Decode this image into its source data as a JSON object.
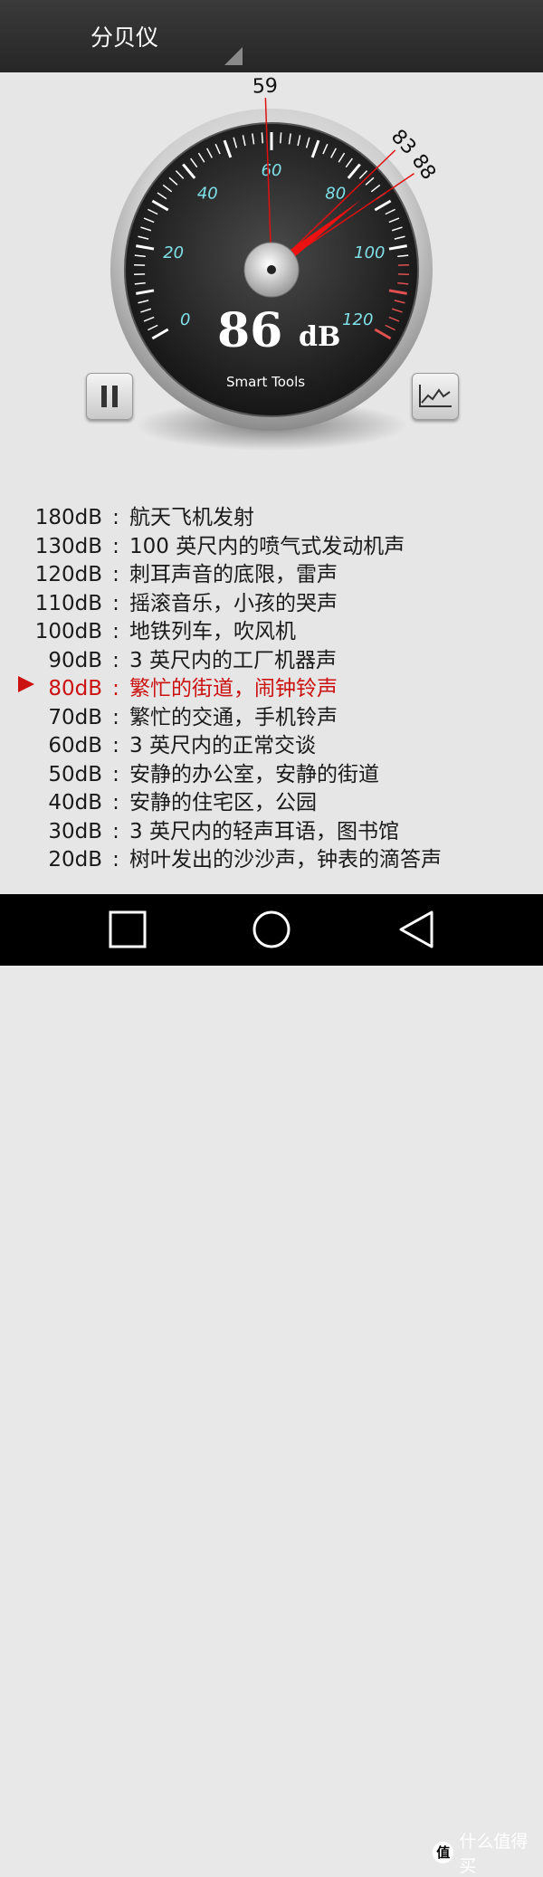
{
  "app": {
    "title": "分贝仪"
  },
  "gauge": {
    "reading": "86",
    "unit": "dB",
    "brand": "Smart Tools",
    "scale_labels": [
      "0",
      "20",
      "40",
      "60",
      "80",
      "100",
      "120"
    ],
    "markers": [
      "59",
      "83",
      "88"
    ],
    "needle_value": 86,
    "min_marker_value": 59,
    "peak_marker_values": [
      83,
      88
    ]
  },
  "reference": [
    {
      "level": "180dB",
      "sep": ":",
      "desc": "航天飞机发射",
      "active": false
    },
    {
      "level": "130dB",
      "sep": ":",
      "desc": "100 英尺内的喷气式发动机声",
      "active": false
    },
    {
      "level": "120dB",
      "sep": ":",
      "desc": "刺耳声音的底限，雷声",
      "active": false
    },
    {
      "level": "110dB",
      "sep": ":",
      "desc": "摇滚音乐，小孩的哭声",
      "active": false
    },
    {
      "level": "100dB",
      "sep": ":",
      "desc": "地铁列车，吹风机",
      "active": false
    },
    {
      "level": "90dB",
      "sep": ":",
      "desc": "3 英尺内的工厂机器声",
      "active": false
    },
    {
      "level": "80dB",
      "sep": ":",
      "desc": "繁忙的街道，闹钟铃声",
      "active": true
    },
    {
      "level": "70dB",
      "sep": ":",
      "desc": "繁忙的交通，手机铃声",
      "active": false
    },
    {
      "level": "60dB",
      "sep": ":",
      "desc": "3 英尺内的正常交谈",
      "active": false
    },
    {
      "level": "50dB",
      "sep": ":",
      "desc": "安静的办公室，安静的街道",
      "active": false
    },
    {
      "level": "40dB",
      "sep": ":",
      "desc": "安静的住宅区，公园",
      "active": false
    },
    {
      "level": "30dB",
      "sep": ":",
      "desc": "3 英尺内的轻声耳语，图书馆",
      "active": false
    },
    {
      "level": "20dB",
      "sep": ":",
      "desc": "树叶发出的沙沙声，钟表的滴答声",
      "active": false
    }
  ],
  "watermark": {
    "badge": "值",
    "text": "什么值得买"
  },
  "colors": {
    "accent": "#cc1111",
    "scale": "#7fe0e8",
    "appbar": "#2e2e2e",
    "background": "#e6e6e6"
  },
  "icons": {
    "pause": "pause-icon",
    "chart": "chart-icon",
    "recents": "square-icon",
    "home": "circle-icon",
    "back": "triangle-back-icon"
  }
}
